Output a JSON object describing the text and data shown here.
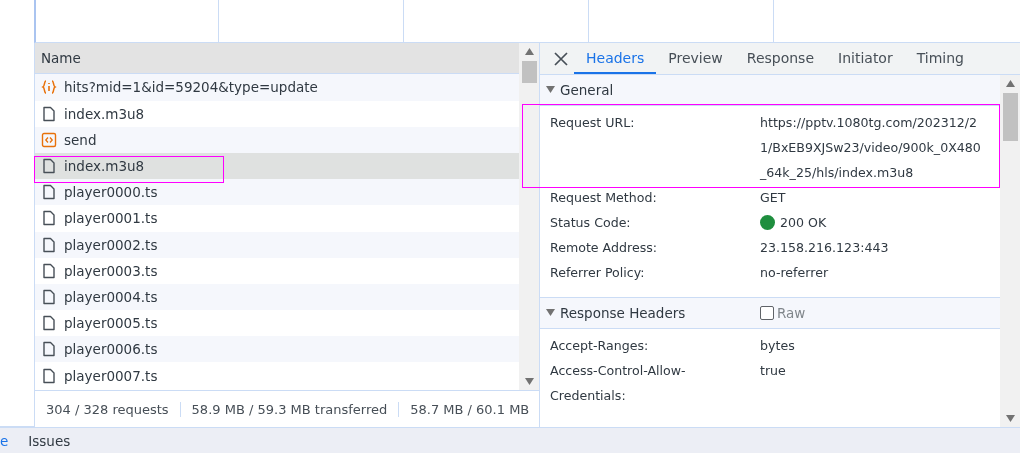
{
  "requests": {
    "column": "Name",
    "rows": [
      {
        "name": "hits?mid=1&id=59204&type=update",
        "kind": "json",
        "selected": false
      },
      {
        "name": "index.m3u8",
        "kind": "file",
        "selected": false
      },
      {
        "name": "send",
        "kind": "script",
        "selected": false
      },
      {
        "name": "index.m3u8",
        "kind": "file",
        "selected": true
      },
      {
        "name": "player0000.ts",
        "kind": "file",
        "selected": false
      },
      {
        "name": "player0001.ts",
        "kind": "file",
        "selected": false
      },
      {
        "name": "player0002.ts",
        "kind": "file",
        "selected": false
      },
      {
        "name": "player0003.ts",
        "kind": "file",
        "selected": false
      },
      {
        "name": "player0004.ts",
        "kind": "file",
        "selected": false
      },
      {
        "name": "player0005.ts",
        "kind": "file",
        "selected": false
      },
      {
        "name": "player0006.ts",
        "kind": "file",
        "selected": false
      },
      {
        "name": "player0007.ts",
        "kind": "file",
        "selected": false
      }
    ],
    "summary": [
      "304 / 328 requests",
      "58.9 MB / 59.3 MB transferred",
      "58.7 MB / 60.1 MB"
    ]
  },
  "details": {
    "tabs": [
      {
        "label": "Headers",
        "selected": true
      },
      {
        "label": "Preview",
        "selected": false
      },
      {
        "label": "Response",
        "selected": false
      },
      {
        "label": "Initiator",
        "selected": false
      },
      {
        "label": "Timing",
        "selected": false
      }
    ],
    "sections": [
      {
        "title": "General",
        "expanded": true,
        "rows": [
          {
            "key": "Request URL:",
            "value": [
              "https://pptv.1080tg.com/202312/2",
              "1/BxEB9XJSw23/video/900k_0X480",
              "_64k_25/hls/index.m3u8"
            ]
          },
          {
            "key": "Request Method:",
            "value": [
              "GET"
            ]
          },
          {
            "key": "Status Code:",
            "value": [
              "200 OK"
            ],
            "color": "#1e8e3e"
          },
          {
            "key": "Remote Address:",
            "value": [
              "23.158.216.123:443"
            ]
          },
          {
            "key": "Referrer Policy:",
            "value": [
              "no-referrer"
            ]
          }
        ]
      },
      {
        "title": "Response Headers",
        "expanded": true,
        "raw": {
          "label": "Raw",
          "checked": false
        },
        "rows": [
          {
            "key": "Accept-Ranges:",
            "value": [
              "bytes"
            ]
          },
          {
            "key": [
              "Access-Control-Allow-",
              "Credentials:"
            ],
            "value": [
              "true"
            ]
          }
        ]
      }
    ]
  },
  "drawer": {
    "tabs": [
      {
        "label": "e",
        "selected": true
      },
      {
        "label": "Issues",
        "selected": false
      }
    ]
  }
}
